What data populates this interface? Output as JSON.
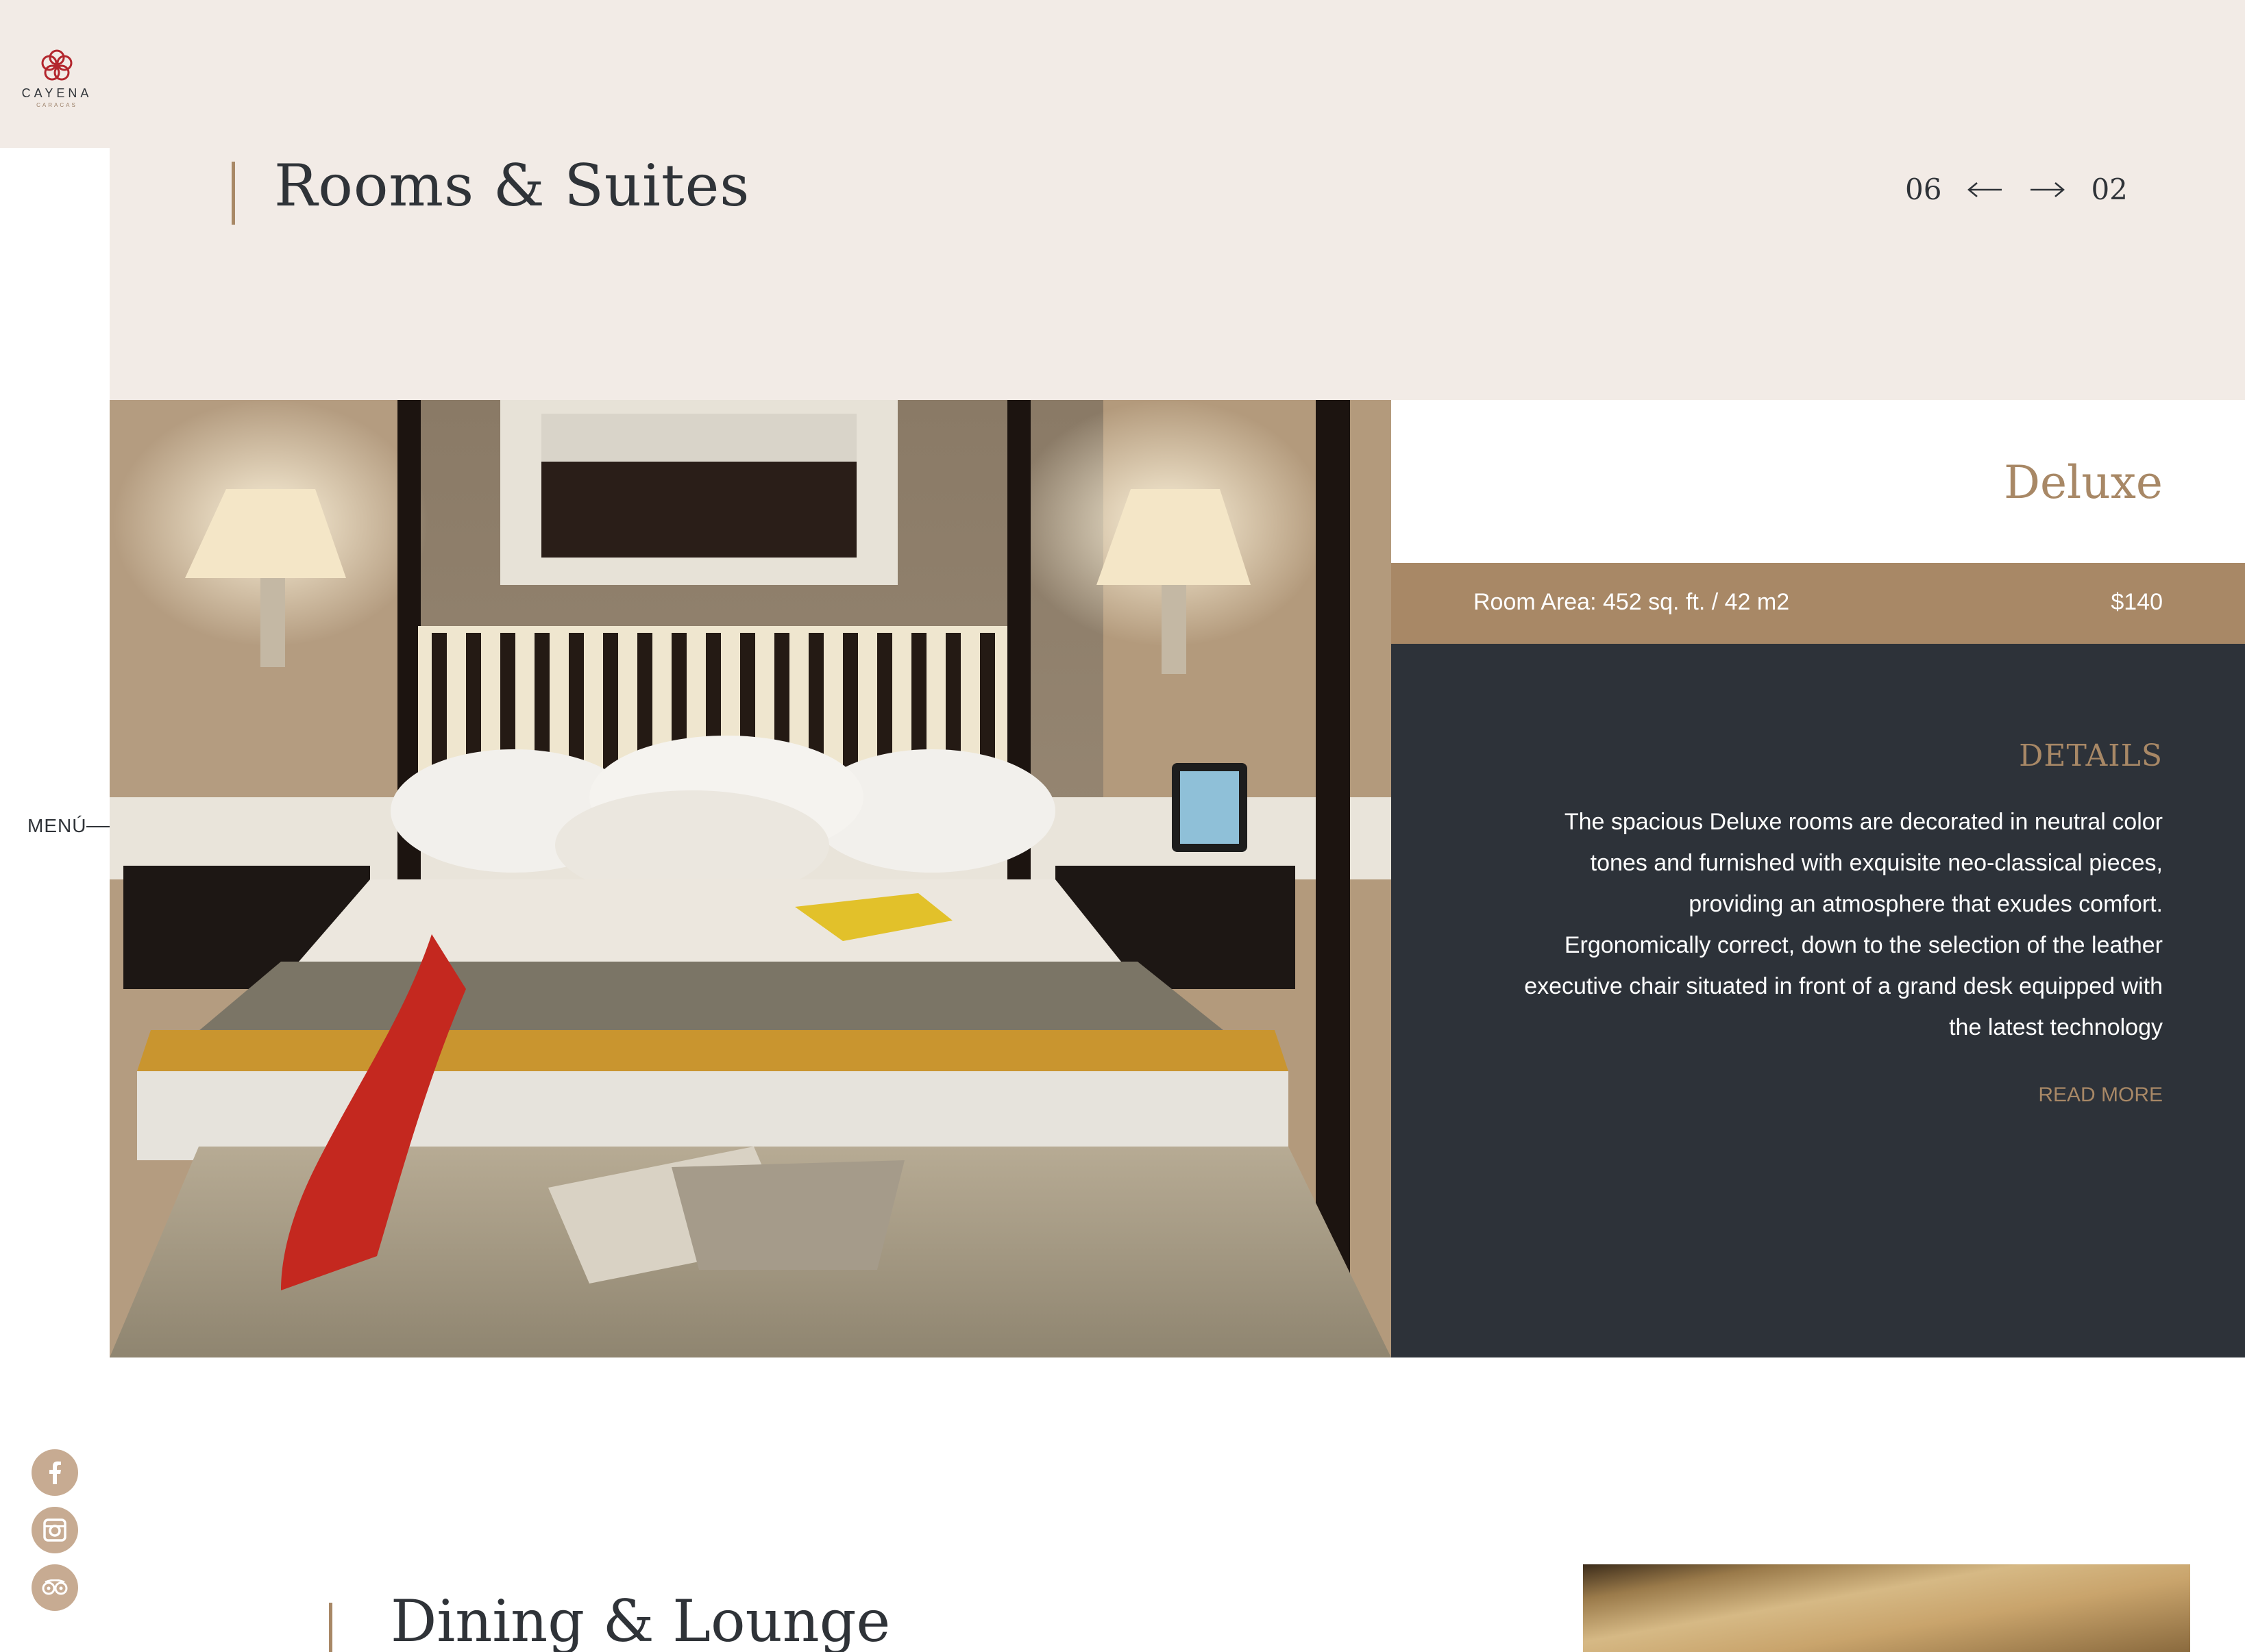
{
  "brand": {
    "name": "CAYENA",
    "tagline": "CARACAS",
    "accent_color": "#a88866",
    "logo_color": "#b3262d"
  },
  "colors": {
    "background_top": "#f2ebe6",
    "panel_dark": "#2d3239",
    "text_dark": "#2f3338",
    "social_bg": "#c7ab92"
  },
  "section": {
    "title": "Rooms & Suites"
  },
  "pager": {
    "total": "06",
    "current": "02",
    "prev_icon": "arrow-left-icon",
    "next_icon": "arrow-right-icon"
  },
  "room": {
    "name": "Deluxe",
    "area": "Room Area: 452 sq. ft. / 42 m2",
    "price": "$140",
    "details_title": "DETAILS",
    "description_lines": [
      "The spacious Deluxe rooms are decorated in neutral color",
      "tones and furnished with exquisite neo-classical pieces,",
      "providing an atmosphere that exudes comfort.",
      "Ergonomically correct, down to the selection of the leather",
      "executive chair situated in front of a grand desk equipped with",
      "the latest technology"
    ],
    "read_more": "READ MORE"
  },
  "side": {
    "menu_label": "MENÚ",
    "social": [
      "facebook-icon",
      "instagram-icon",
      "tripadvisor-icon"
    ]
  },
  "next_section": {
    "title": "Dining & Lounge"
  }
}
